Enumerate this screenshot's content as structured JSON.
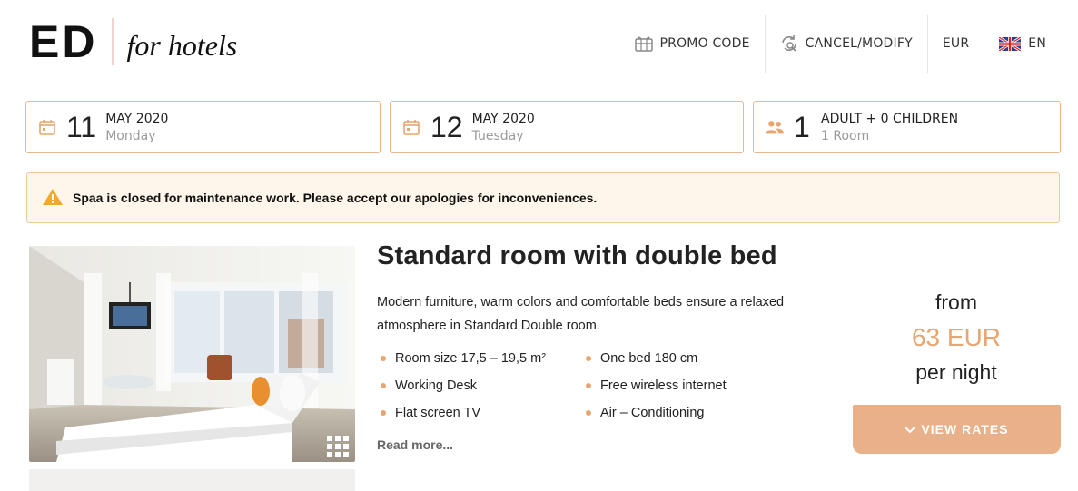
{
  "brand": {
    "name": "ED",
    "tagline": "for hotels"
  },
  "topnav": {
    "promo_code": "PROMO CODE",
    "cancel_modify": "CANCEL/MODIFY",
    "currency": "EUR",
    "language": "EN"
  },
  "search": {
    "checkin": {
      "day": "11",
      "month_year": "MAY 2020",
      "weekday": "Monday"
    },
    "checkout": {
      "day": "12",
      "month_year": "MAY 2020",
      "weekday": "Tuesday"
    },
    "guests": {
      "count": "1",
      "summary": "ADULT + 0 CHILDREN",
      "rooms": "1 Room"
    }
  },
  "alert": {
    "icon": "warning-icon",
    "message": "Spaa is closed for maintenance work. Please accept our apologies for inconveniences."
  },
  "room": {
    "title": "Standard room with double bed",
    "description": "Modern furniture, warm colors and comfortable beds ensure a relaxed atmosphere in Standard Double room.",
    "amenities": [
      "Room size 17,5 – 19,5 m²",
      "One bed 180 cm",
      "Working Desk",
      "Free wireless internet",
      "Flat screen TV",
      "Air – Conditioning"
    ],
    "read_more": "Read more...",
    "price": {
      "from": "from",
      "amount": "63 EUR",
      "per": "per night"
    },
    "view_rates": "VIEW RATES"
  },
  "colors": {
    "accent": "#e8a56f",
    "button": "#e8b18a",
    "border": "#e8b790",
    "alert_bg": "#fef6ea"
  }
}
